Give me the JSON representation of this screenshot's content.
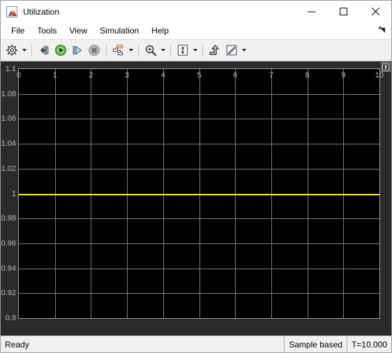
{
  "window": {
    "title": "Utilization",
    "app_icon": "matlab-scope-icon",
    "caption": {
      "minimize": "minimize-icon",
      "maximize": "maximize-icon",
      "close": "close-icon"
    }
  },
  "menubar": {
    "items": [
      {
        "label": "File",
        "name": "menu-file"
      },
      {
        "label": "Tools",
        "name": "menu-tools"
      },
      {
        "label": "View",
        "name": "menu-view"
      },
      {
        "label": "Simulation",
        "name": "menu-simulation"
      },
      {
        "label": "Help",
        "name": "menu-help"
      }
    ],
    "overflow_icon": "menu-overflow-icon"
  },
  "toolbar": {
    "buttons": [
      {
        "name": "configuration-properties-button",
        "icon": "gear-icon",
        "caret": true
      },
      {
        "name": "step-back-button",
        "icon": "step-back-icon",
        "caret": false
      },
      {
        "name": "run-button",
        "icon": "play-icon",
        "caret": false
      },
      {
        "name": "step-forward-button",
        "icon": "step-forward-icon",
        "caret": false
      },
      {
        "name": "stop-button",
        "icon": "stop-icon",
        "caret": false
      },
      {
        "name": "signal-selector-button",
        "icon": "signal-hierarchy-icon",
        "caret": true
      },
      {
        "name": "zoom-button",
        "icon": "zoom-in-icon",
        "caret": true
      },
      {
        "name": "autoscale-button",
        "icon": "autoscale-icon",
        "caret": true
      },
      {
        "name": "style-button",
        "icon": "style-arrow-icon",
        "caret": false
      },
      {
        "name": "measurements-button",
        "icon": "ruler-icon",
        "caret": true
      }
    ]
  },
  "scope": {
    "corner_button": "expand-icon"
  },
  "statusbar": {
    "ready_label": "Ready",
    "frame_mode": "Sample based",
    "time": "T=10.000"
  },
  "chart_data": {
    "type": "line",
    "title": "",
    "xlabel": "",
    "ylabel": "",
    "xlim": [
      0,
      10
    ],
    "ylim": [
      0.9,
      1.1
    ],
    "xticks": [
      0,
      1,
      2,
      3,
      4,
      5,
      6,
      7,
      8,
      9,
      10
    ],
    "xticklabels": [
      "0",
      "1",
      "2",
      "3",
      "4",
      "5",
      "6",
      "7",
      "8",
      "9",
      "10"
    ],
    "yticks": [
      0.9,
      0.92,
      0.94,
      0.96,
      0.98,
      1,
      1.02,
      1.04,
      1.06,
      1.08,
      1.1
    ],
    "yticklabels": [
      "0.9",
      "0.92",
      "0.94",
      "0.96",
      "0.98",
      "1",
      "1.02",
      "1.04",
      "1.06",
      "1.08",
      "1.1"
    ],
    "grid": true,
    "background": "#000000",
    "gridcolor": "#7d7d7d",
    "series": [
      {
        "name": "Utilization",
        "color": "#ffff00",
        "x": [
          0,
          10
        ],
        "values": [
          1,
          1
        ]
      }
    ]
  }
}
